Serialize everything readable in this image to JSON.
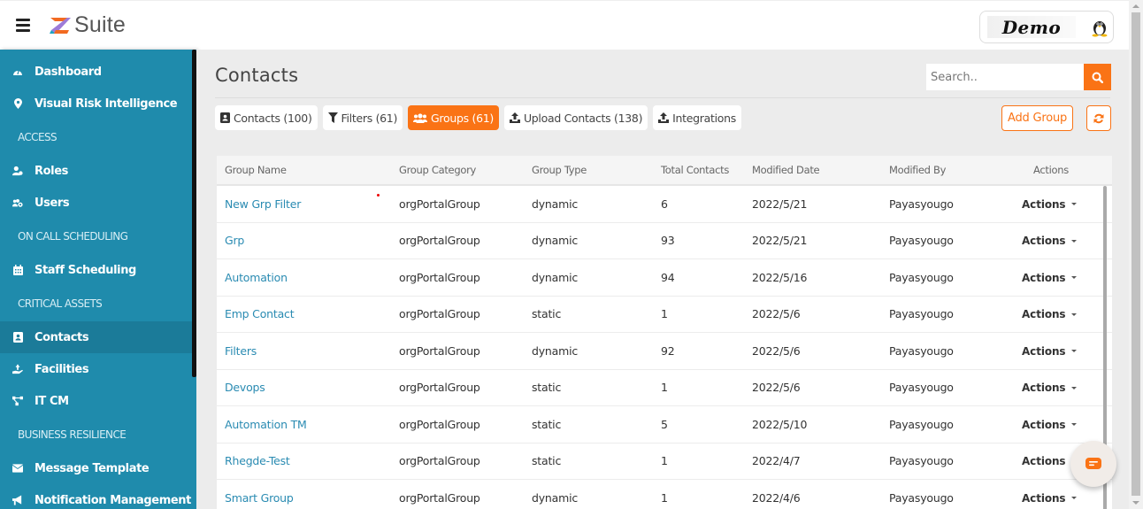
{
  "header": {
    "app_name": "Suite",
    "profile_badge": "Demo",
    "profile_icon": "tux-avatar-icon"
  },
  "sidebar": {
    "items": [
      {
        "type": "item",
        "label": "Dashboard",
        "icon": "dashboard-icon"
      },
      {
        "type": "item",
        "label": "Visual Risk Intelligence",
        "icon": "map-marker-icon"
      },
      {
        "type": "section",
        "label": "ACCESS"
      },
      {
        "type": "item",
        "label": "Roles",
        "icon": "user-role-icon"
      },
      {
        "type": "item",
        "label": "Users",
        "icon": "users-icon"
      },
      {
        "type": "section",
        "label": "ON CALL SCHEDULING"
      },
      {
        "type": "item",
        "label": "Staff Scheduling",
        "icon": "calendar-icon"
      },
      {
        "type": "section",
        "label": "CRITICAL ASSETS"
      },
      {
        "type": "item",
        "label": "Contacts",
        "icon": "contact-book-icon",
        "active": true
      },
      {
        "type": "item",
        "label": "Facilities",
        "icon": "facility-hand-icon"
      },
      {
        "type": "item",
        "label": "IT CM",
        "icon": "network-icon"
      },
      {
        "type": "section",
        "label": "BUSINESS RESILIENCE"
      },
      {
        "type": "item",
        "label": "Message Template",
        "icon": "envelope-icon"
      },
      {
        "type": "item",
        "label": "Notification Management",
        "icon": "megaphone-icon"
      }
    ]
  },
  "main": {
    "title": "Contacts",
    "search": {
      "placeholder": "Search..",
      "value": ""
    },
    "tabs": [
      {
        "label": "Contacts (100)",
        "icon": "contact-card-icon",
        "active": false
      },
      {
        "label": "Filters (61)",
        "icon": "filter-icon",
        "active": false
      },
      {
        "label": "Groups (61)",
        "icon": "groups-icon",
        "active": true
      },
      {
        "label": "Upload Contacts (138)",
        "icon": "upload-icon",
        "active": false
      },
      {
        "label": "Integrations",
        "icon": "upload-icon",
        "active": false
      }
    ],
    "add_group_label": "Add Group",
    "colors": {
      "accent": "#fa7315",
      "sidebar": "#1f8bac",
      "link": "#2a8bb2"
    },
    "table": {
      "columns": [
        "Group Name",
        "Group Category",
        "Group Type",
        "Total Contacts",
        "Modified Date",
        "Modified By",
        "Actions"
      ],
      "rows": [
        {
          "name": "New Grp Filter",
          "category": "orgPortalGroup",
          "type": "dynamic",
          "total": "6",
          "date": "2022/5/21",
          "by": "Payasyougo",
          "action": "Actions"
        },
        {
          "name": "Grp",
          "category": "orgPortalGroup",
          "type": "dynamic",
          "total": "93",
          "date": "2022/5/21",
          "by": "Payasyougo",
          "action": "Actions"
        },
        {
          "name": "Automation",
          "category": "orgPortalGroup",
          "type": "dynamic",
          "total": "94",
          "date": "2022/5/16",
          "by": "Payasyougo",
          "action": "Actions"
        },
        {
          "name": "Emp Contact",
          "category": "orgPortalGroup",
          "type": "static",
          "total": "1",
          "date": "2022/5/6",
          "by": "Payasyougo",
          "action": "Actions"
        },
        {
          "name": "Filters",
          "category": "orgPortalGroup",
          "type": "dynamic",
          "total": "92",
          "date": "2022/5/6",
          "by": "Payasyougo",
          "action": "Actions"
        },
        {
          "name": "Devops",
          "category": "orgPortalGroup",
          "type": "static",
          "total": "1",
          "date": "2022/5/6",
          "by": "Payasyougo",
          "action": "Actions"
        },
        {
          "name": "Automation TM",
          "category": "orgPortalGroup",
          "type": "static",
          "total": "5",
          "date": "2022/5/10",
          "by": "Payasyougo",
          "action": "Actions"
        },
        {
          "name": "Rhegde-Test",
          "category": "orgPortalGroup",
          "type": "static",
          "total": "1",
          "date": "2022/4/7",
          "by": "Payasyougo",
          "action": "Actions"
        },
        {
          "name": "Smart Group",
          "category": "orgPortalGroup",
          "type": "dynamic",
          "total": "1",
          "date": "2022/4/6",
          "by": "Payasyougo",
          "action": "Actions"
        }
      ]
    }
  },
  "chat_widget": {
    "icon": "chat-bubble-icon"
  }
}
